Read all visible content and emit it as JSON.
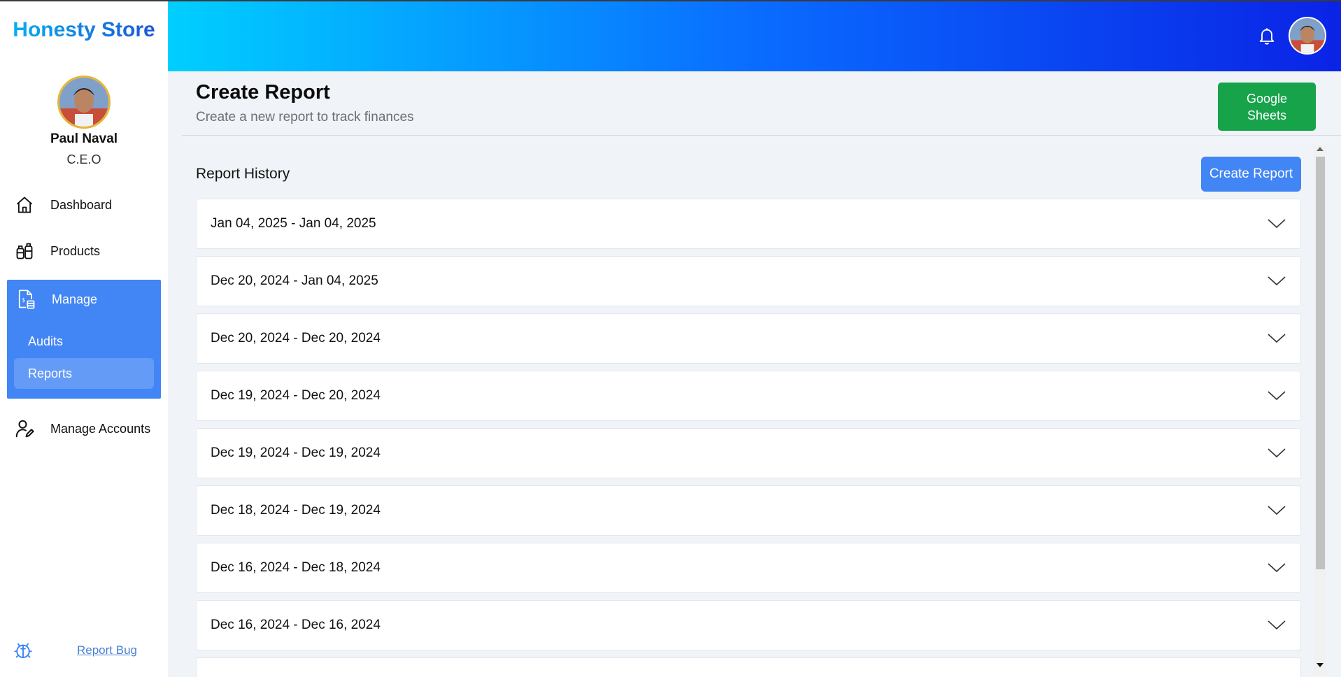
{
  "app": {
    "brand": "Honesty Store"
  },
  "profile": {
    "name": "Paul Naval",
    "role": "C.E.O",
    "avatar_icon": "user-avatar"
  },
  "sidebar": {
    "items": [
      {
        "label": "Dashboard",
        "icon": "home-icon"
      },
      {
        "label": "Products",
        "icon": "products-icon"
      },
      {
        "label": "Manage",
        "icon": "manage-document-icon",
        "active": true,
        "children": [
          {
            "label": "Audits"
          },
          {
            "label": "Reports",
            "active": true
          }
        ]
      },
      {
        "label": "Manage Accounts",
        "icon": "user-edit-icon"
      }
    ],
    "report_bug": "Report Bug"
  },
  "header": {
    "notification_icon": "bell-icon",
    "avatar_icon": "user-avatar"
  },
  "page": {
    "title": "Create Report",
    "subtitle": "Create a new report to track finances",
    "google_sheets_label": "Google Sheets"
  },
  "history": {
    "title": "Report History",
    "create_label": "Create Report",
    "reports": [
      {
        "range": "Jan 04, 2025 - Jan 04, 2025"
      },
      {
        "range": "Dec 20, 2024 - Jan 04, 2025"
      },
      {
        "range": "Dec 20, 2024 - Dec 20, 2024"
      },
      {
        "range": "Dec 19, 2024 - Dec 20, 2024"
      },
      {
        "range": "Dec 19, 2024 - Dec 19, 2024"
      },
      {
        "range": "Dec 18, 2024 - Dec 19, 2024"
      },
      {
        "range": "Dec 16, 2024 - Dec 18, 2024"
      },
      {
        "range": "Dec 16, 2024 - Dec 16, 2024"
      },
      {
        "range": ""
      }
    ]
  },
  "colors": {
    "accent": "#4285f4",
    "success": "#16a34a",
    "header_gradient_start": "#00cfff",
    "header_gradient_end": "#0a23e6"
  }
}
